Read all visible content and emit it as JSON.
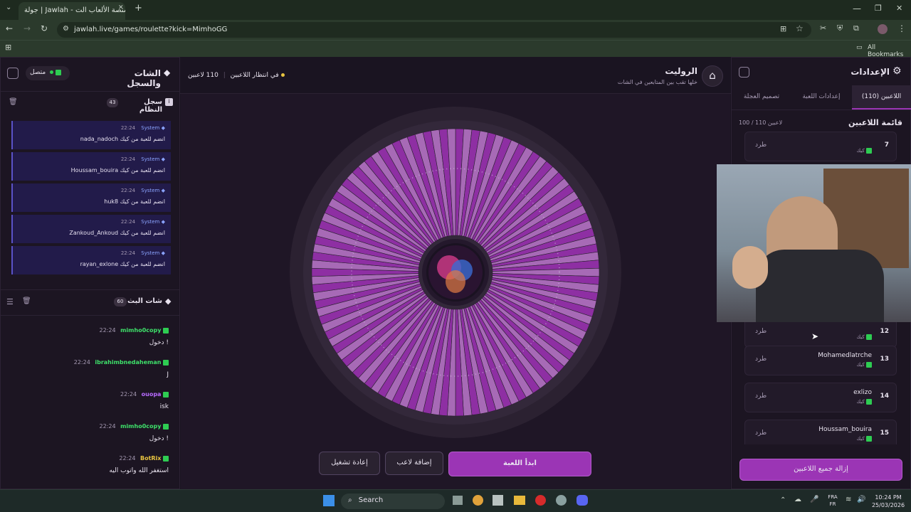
{
  "browser": {
    "tab_title": "جولة | Jawlah - منصة الألعاب الت...",
    "tab_badge": "جولة",
    "url": "jawlah.live/games/roulette?kick=MimhoGG",
    "all_bookmarks": "All Bookmarks",
    "icons": [
      "tab-search-icon",
      "new-tab-icon",
      "back-icon",
      "forward-icon",
      "reload-icon",
      "site-info-icon",
      "translate-icon",
      "star-icon",
      "extension-icon",
      "shield-icon",
      "puzzle-icon",
      "profile-icon",
      "more-icon",
      "apps-icon",
      "folder-icon",
      "minimize-icon",
      "maximize-icon",
      "close-icon"
    ]
  },
  "header": {
    "title": "الروليت",
    "subtitle": "خلها تقب بين المتابعين في الشات",
    "player_count": "110 لاعبين",
    "status": "في انتظار اللاعبين"
  },
  "chat_panel": {
    "title": "الشات والسجل",
    "connection": "متصل",
    "system_log_title": "سجل النظام",
    "system_log_count": "43",
    "system_messages": [
      {
        "user": "System",
        "time": "22:24",
        "text": "nada_nadoch انضم للعبة من كيك"
      },
      {
        "user": "System",
        "time": "22:24",
        "text": "Houssam_bouira انضم للعبة من كيك"
      },
      {
        "user": "System",
        "time": "22:24",
        "text": "huk8 انضم للعبة من كيك"
      },
      {
        "user": "System",
        "time": "22:24",
        "text": "Zankoud_Ankoud انضم للعبة من كيك"
      },
      {
        "user": "System",
        "time": "22:24",
        "text": "rayan_exlone انضم للعبة من كيك"
      }
    ],
    "stream_chat_title": "شات البث",
    "stream_chat_count": "60",
    "chat_messages": [
      {
        "user": "mimho0copy",
        "time": "22:24",
        "text": "دخول !",
        "color": "#3ee06a"
      },
      {
        "user": "ibrahimbnedaheman",
        "time": "22:24",
        "text": "J",
        "color": "#3ee06a"
      },
      {
        "user": "ouopa",
        "time": "22:24",
        "text": "isk",
        "color": "#b86bff"
      },
      {
        "user": "mimho0copy",
        "time": "22:24",
        "text": "دخول !",
        "color": "#3ee06a"
      },
      {
        "user": "BotRix",
        "time": "22:24",
        "text": "استغفر الله واتوب اليه",
        "color": "#e8c440"
      }
    ]
  },
  "controls": {
    "start": "ابدأ اللعبة",
    "add_player": "إضافة لاعب",
    "restart": "إعادة تشغيل"
  },
  "wheel": {
    "segments": 110,
    "color_a": "#8e2fa3",
    "color_b": "#a76ab6"
  },
  "settings": {
    "title": "الإعدادات",
    "tabs": [
      "اللاعبين (110)",
      "إعدادات اللعبة",
      "تصميم العجلة"
    ],
    "list_title": "قائمة اللاعبين",
    "list_count": "100 / 110 لاعبين",
    "kick_label": "طرد",
    "source_label": "كيك",
    "players": [
      {
        "rank": "7",
        "name": ""
      },
      {
        "rank": "12",
        "name": ""
      },
      {
        "rank": "13",
        "name": "Mohamedlatrche"
      },
      {
        "rank": "14",
        "name": "exlizo"
      },
      {
        "rank": "15",
        "name": "Houssam_bouira"
      }
    ],
    "remove_all": "إزالة جميع اللاعبين"
  },
  "taskbar": {
    "search": "Search",
    "lang_top": "FRA",
    "lang_bottom": "FR",
    "time": "10:24 PM",
    "date": "25/03/2026"
  },
  "colors": {
    "accent": "#9b35b5",
    "kick_green": "#2ecc52",
    "system_blue": "#8ba4ff"
  }
}
